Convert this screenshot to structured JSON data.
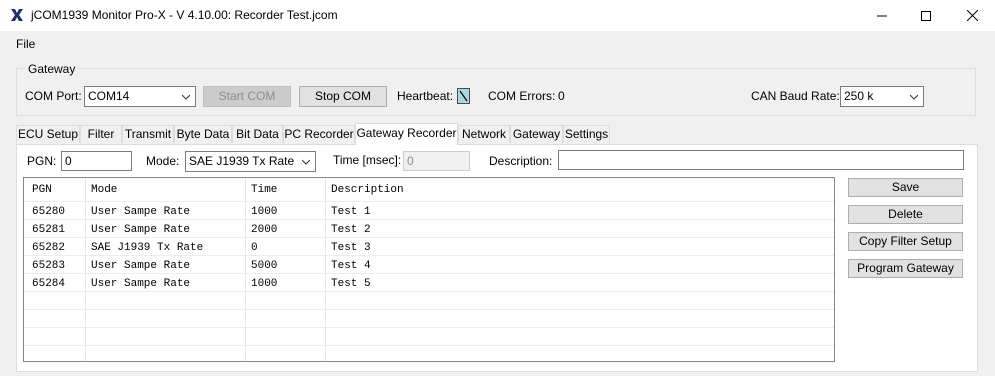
{
  "window": {
    "title": "jCOM1939 Monitor Pro-X - V 4.10.00: Recorder Test.jcom"
  },
  "menu": {
    "file": "File"
  },
  "gateway": {
    "legend": "Gateway",
    "com_port_label": "COM Port:",
    "com_port_value": "COM14",
    "start_com": "Start COM",
    "stop_com": "Stop COM",
    "heartbeat_label": "Heartbeat:",
    "com_errors_label": "COM Errors:",
    "com_errors_value": "0",
    "baud_label": "CAN Baud Rate:",
    "baud_value": "250 k"
  },
  "tabs": [
    {
      "label": "ECU Setup"
    },
    {
      "label": "Filter"
    },
    {
      "label": "Transmit"
    },
    {
      "label": "Byte Data"
    },
    {
      "label": "Bit Data"
    },
    {
      "label": "PC Recorder"
    },
    {
      "label": "Gateway Recorder",
      "active": true
    },
    {
      "label": "Network"
    },
    {
      "label": "Gateway"
    },
    {
      "label": "Settings"
    }
  ],
  "form": {
    "pgn_label": "PGN:",
    "pgn_value": "0",
    "mode_label": "Mode:",
    "mode_value": "SAE J1939 Tx Rate",
    "time_label": "Time [msec]:",
    "time_value": "0",
    "description_label": "Description:",
    "description_value": ""
  },
  "table": {
    "columns": [
      "PGN",
      "Mode",
      "Time",
      "Description"
    ],
    "rows": [
      [
        "65280",
        "User Sampe Rate",
        "1000",
        "Test 1"
      ],
      [
        "65281",
        "User Sampe Rate",
        "2000",
        "Test 2"
      ],
      [
        "65282",
        "SAE J1939 Tx Rate",
        "0",
        "Test 3"
      ],
      [
        "65283",
        "User Sampe Rate",
        "5000",
        "Test 4"
      ],
      [
        "65284",
        "User Sampe Rate",
        "1000",
        "Test 5"
      ]
    ]
  },
  "actions": {
    "save": "Save",
    "delete": "Delete",
    "copy_filter": "Copy Filter Setup",
    "program_gateway": "Program Gateway"
  },
  "icons": {
    "app": "app-logo-icon",
    "minimize": "minimize-icon",
    "maximize": "maximize-icon",
    "close": "close-icon",
    "heartbeat": "heartbeat-indicator-icon"
  },
  "colors": {
    "heartbeat_fill": "#a8d8e8",
    "window_bg": "#f0f0f0"
  }
}
